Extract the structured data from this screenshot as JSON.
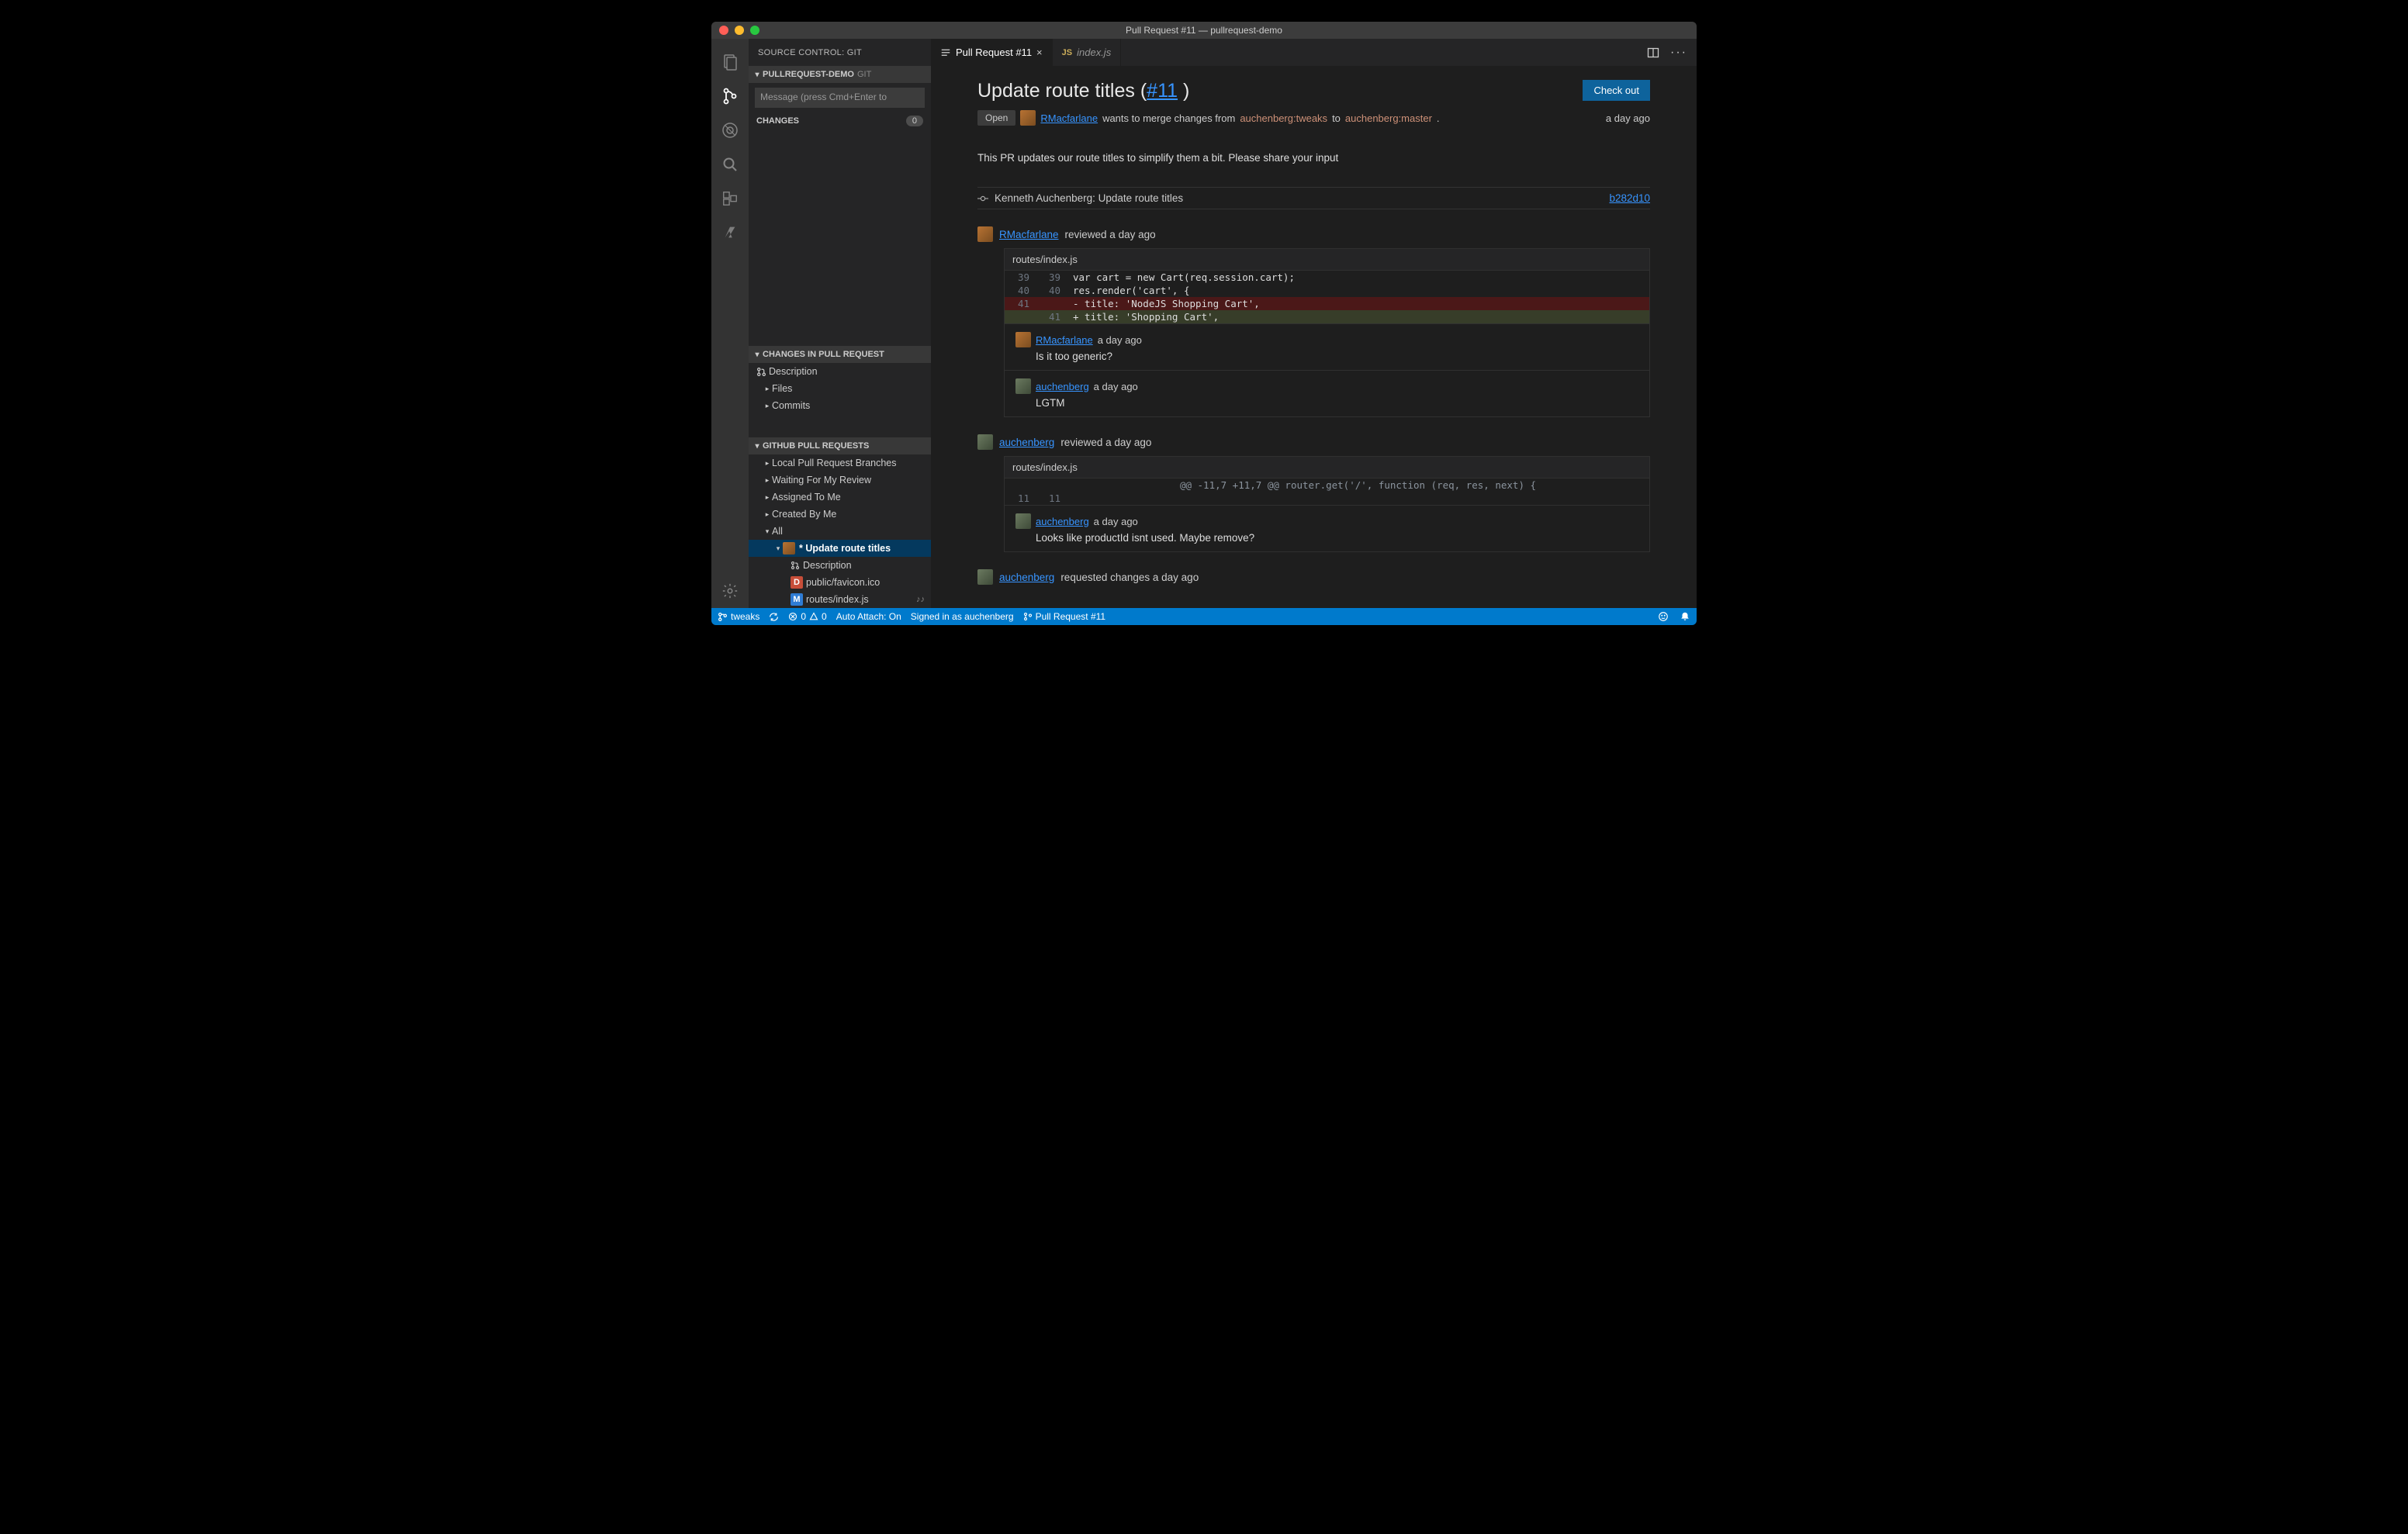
{
  "window": {
    "title": "Pull Request #11 — pullrequest-demo"
  },
  "sidebar": {
    "title": "SOURCE CONTROL: GIT",
    "repo_section": {
      "label": "PULLREQUEST-DEMO",
      "sub": "GIT"
    },
    "message_placeholder": "Message (press Cmd+Enter to",
    "changes_label": "CHANGES",
    "changes_count": "0",
    "pr_section": "CHANGES IN PULL REQUEST",
    "pr_items": {
      "description": "Description",
      "files": "Files",
      "commits": "Commits"
    },
    "gh_section": "GITHUB PULL REQUESTS",
    "gh_items": {
      "local": "Local Pull Request Branches",
      "waiting": "Waiting For My Review",
      "assigned": "Assigned To Me",
      "created": "Created By Me",
      "all": "All",
      "selected": "* Update route titles",
      "sel_desc": "Description",
      "sel_file1": "public/favicon.ico",
      "sel_file2": "routes/index.js",
      "sel_file2_deco": "♪♪"
    }
  },
  "tabs": {
    "t1": "Pull Request #11",
    "t2": "index.js"
  },
  "pr": {
    "title_text": "Update route titles (",
    "title_num": "#11",
    "title_close": " )",
    "checkout": "Check out",
    "state": "Open",
    "author": "RMacfarlane",
    "merge_text": " wants to merge changes from ",
    "from_branch": "auchenberg:tweaks",
    "to_word": " to ",
    "to_branch": "auchenberg:master",
    "period": ".",
    "ago": "a day ago",
    "description": "This PR updates our route titles to simplify them a bit. Please share your input",
    "commit_author": "Kenneth Auchenberg: Update route titles",
    "commit_sha": "b282d10"
  },
  "review1": {
    "author": "RMacfarlane",
    "action": "reviewed a day ago",
    "file": "routes/index.js",
    "lines": [
      {
        "old": "39",
        "new": "39",
        "code": "var cart = new Cart(req.session.cart);",
        "cls": ""
      },
      {
        "old": "40",
        "new": "40",
        "code": "res.render('cart', {",
        "cls": ""
      },
      {
        "old": "41",
        "new": "",
        "code": "- title: 'NodeJS Shopping Cart',",
        "cls": "del"
      },
      {
        "old": "",
        "new": "41",
        "code": "+ title: 'Shopping Cart',",
        "cls": "add"
      }
    ],
    "c1_author": "RMacfarlane",
    "c1_ago": "a day ago",
    "c1_body": "Is it too generic?",
    "c2_author": "auchenberg",
    "c2_ago": "a day ago",
    "c2_body": "LGTM"
  },
  "review2": {
    "author": "auchenberg",
    "action": "reviewed a day ago",
    "file": "routes/index.js",
    "hunk": "@@ -11,7 +11,7 @@ router.get('/', function (req, res, next) {",
    "old": "11",
    "new": "11",
    "c1_author": "auchenberg",
    "c1_ago": "a day ago",
    "c1_body": "Looks like productId isnt used. Maybe remove?"
  },
  "review3": {
    "author": "auchenberg",
    "action": "requested changes a day ago"
  },
  "status": {
    "branch": "tweaks",
    "errors": "0",
    "warnings": "0",
    "auto_attach": "Auto Attach: On",
    "signed_in": "Signed in as auchenberg",
    "pr": "Pull Request #11"
  }
}
